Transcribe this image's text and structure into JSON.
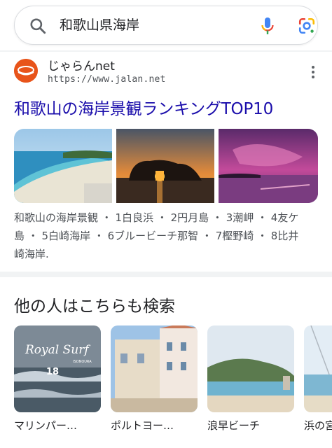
{
  "search": {
    "query": "和歌山県海岸",
    "icons": [
      "search-icon",
      "microphone-icon",
      "google-lens-icon"
    ]
  },
  "result": {
    "site_name": "じゃらんnet",
    "url": "https://www.jalan.net",
    "title": "和歌山の海岸景観ランキングTOP10",
    "snippet_line1": "和歌山の海岸景観 ・ 1白良浜 ・ 2円月島 ・ 3潮岬 ・ 4友ケ",
    "snippet_line2": "島 ・ 5白崎海岸 ・ 6ブルービーチ那智 ・ 7樫野崎 ・ 8比井",
    "snippet_line3": "崎海岸.",
    "images": [
      "beach-photo",
      "engetsu-island-sunset-photo",
      "purple-sky-coast-photo"
    ]
  },
  "related": {
    "heading": "他の人はこちらも検索",
    "items": [
      {
        "label": "マリンパー…",
        "overlay_text": "Royal Surf",
        "overlay_sub": "ISONOURA",
        "overlay_num": "18"
      },
      {
        "label": "ポルトヨー…"
      },
      {
        "label": "浪早ビーチ"
      },
      {
        "label": "浜の宮"
      }
    ]
  },
  "colors": {
    "link": "#1a0dab",
    "text": "#202124",
    "secondary": "#4d5156",
    "logo": "#e8541a"
  }
}
